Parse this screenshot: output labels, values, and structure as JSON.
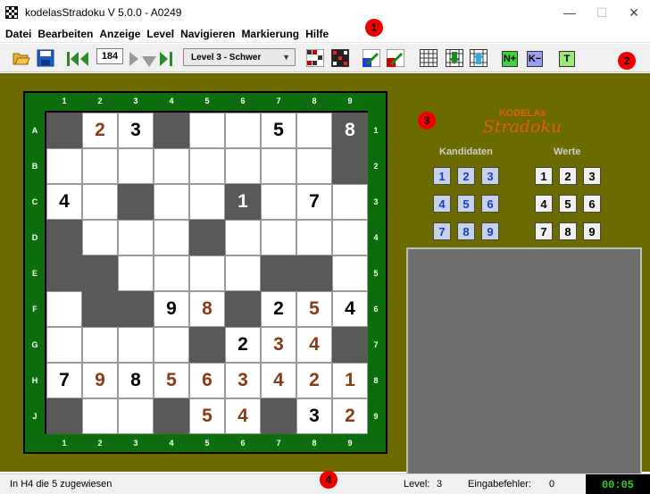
{
  "window": {
    "title": "kodelasStradoku V 5.0.0 - A0249",
    "minimize": "—",
    "maximize": "☐",
    "close": "✕"
  },
  "menu": [
    "Datei",
    "Bearbeiten",
    "Anzeige",
    "Level",
    "Navigieren",
    "Markierung",
    "Hilfe"
  ],
  "markers": [
    "1",
    "2",
    "3",
    "4"
  ],
  "toolbar": {
    "counter": "184",
    "level_select": "Level 3   -   Schwer",
    "btn_n": "N+",
    "btn_k": "K−",
    "btn_t": "T"
  },
  "board": {
    "col_labels": [
      "1",
      "2",
      "3",
      "4",
      "5",
      "6",
      "7",
      "8",
      "9"
    ],
    "row_labels": [
      "A",
      "B",
      "C",
      "D",
      "E",
      "F",
      "G",
      "H",
      "J"
    ],
    "dark": [
      [
        1,
        0,
        0,
        1,
        0,
        0,
        0,
        0,
        1
      ],
      [
        0,
        0,
        0,
        0,
        0,
        0,
        0,
        0,
        1
      ],
      [
        0,
        0,
        1,
        0,
        0,
        1,
        0,
        0,
        0
      ],
      [
        1,
        0,
        0,
        0,
        1,
        0,
        0,
        0,
        0
      ],
      [
        1,
        1,
        0,
        0,
        0,
        0,
        1,
        1,
        0
      ],
      [
        0,
        1,
        1,
        0,
        0,
        1,
        0,
        0,
        0
      ],
      [
        0,
        0,
        0,
        0,
        1,
        0,
        0,
        0,
        1
      ],
      [
        0,
        0,
        0,
        0,
        0,
        0,
        0,
        0,
        0
      ],
      [
        1,
        0,
        0,
        1,
        0,
        0,
        1,
        0,
        0
      ]
    ],
    "values": [
      [
        "",
        "2",
        "3",
        "",
        "",
        "",
        "5",
        "",
        "8"
      ],
      [
        "",
        "",
        "",
        "",
        "",
        "",
        "",
        "",
        ""
      ],
      [
        "4",
        "",
        "",
        "",
        "",
        "1",
        "",
        "7",
        ""
      ],
      [
        "",
        "",
        "",
        "",
        "",
        "",
        "",
        "",
        ""
      ],
      [
        "",
        "",
        "",
        "",
        "",
        "",
        "",
        "",
        ""
      ],
      [
        "",
        "",
        "",
        "9",
        "8",
        "",
        "2",
        "5",
        "4"
      ],
      [
        "",
        "",
        "",
        "",
        "",
        "2",
        "3",
        "4",
        ""
      ],
      [
        "7",
        "9",
        "8",
        "5",
        "6",
        "3",
        "4",
        "2",
        "1"
      ],
      [
        "",
        "",
        "",
        "",
        "5",
        "4",
        "",
        "3",
        "2"
      ]
    ],
    "kinds": [
      [
        "",
        "u",
        "g",
        "",
        "",
        "",
        "g",
        "",
        "g"
      ],
      [
        "",
        "",
        "",
        "",
        "",
        "",
        "",
        "",
        ""
      ],
      [
        "g",
        "",
        "",
        "",
        "",
        "g",
        "",
        "g",
        ""
      ],
      [
        "",
        "",
        "",
        "",
        "",
        "",
        "",
        "",
        ""
      ],
      [
        "",
        "",
        "",
        "",
        "",
        "",
        "",
        "",
        ""
      ],
      [
        "",
        "",
        "",
        "g",
        "u",
        "",
        "g",
        "u",
        "g"
      ],
      [
        "",
        "",
        "",
        "",
        "",
        "g",
        "u",
        "u",
        ""
      ],
      [
        "g",
        "u",
        "g",
        "u",
        "u",
        "u",
        "u",
        "u",
        "u"
      ],
      [
        "",
        "",
        "",
        "",
        "u",
        "u",
        "",
        "g",
        "u"
      ]
    ]
  },
  "logo": {
    "top": "KODELAs",
    "main": "Stradoku"
  },
  "candidates": {
    "title": "Kandidaten",
    "buttons": [
      "1",
      "2",
      "3",
      "4",
      "5",
      "6",
      "7",
      "8",
      "9"
    ]
  },
  "values_pad": {
    "title": "Werte",
    "buttons": [
      "1",
      "2",
      "3",
      "4",
      "5",
      "6",
      "7",
      "8",
      "9"
    ]
  },
  "status": {
    "message": "In H4 die 5 zugewiesen",
    "level_label": "Level:",
    "level_value": "3",
    "errors_label": "Eingabefehler:",
    "errors_value": "0",
    "timer": "00:05"
  },
  "colors": {
    "background": "#6b6b00",
    "board_frame": "#0c6d0c",
    "dark_cell": "#595959",
    "user_digit": "#8a3a14",
    "logo": "#e06010",
    "timer": "#2fd02f"
  }
}
